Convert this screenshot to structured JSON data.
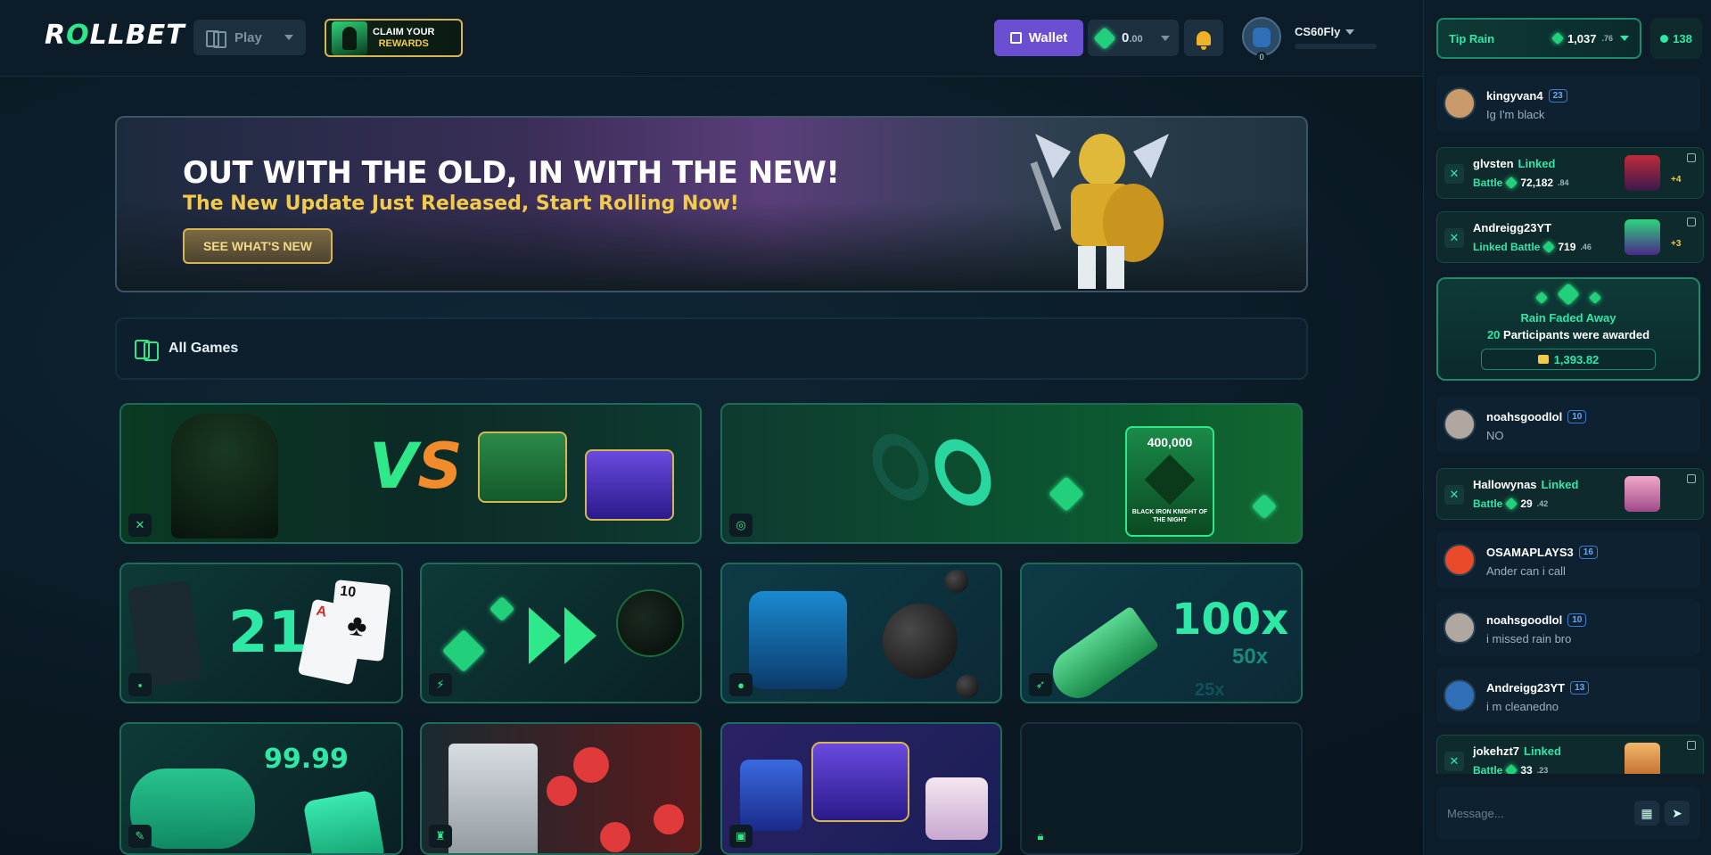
{
  "header": {
    "logo": "ROLLBET",
    "play_label": "Play",
    "claim_line1": "CLAIM YOUR",
    "claim_line2": "REWARDS",
    "wallet_label": "Wallet",
    "balance_main": "0",
    "balance_cents": ".00",
    "username": "CS60Fly",
    "avatar_level": "0"
  },
  "banner": {
    "title": "OUT WITH THE OLD, IN WITH THE NEW!",
    "subtitle": "The New Update Just Released, Start Rolling Now!",
    "cta": "SEE WHAT'S NEW"
  },
  "games": {
    "section_title": "All Games",
    "tiles": [
      {
        "name": "battles",
        "text": "VS"
      },
      {
        "name": "rain",
        "text": "400,000",
        "sub": "BLACK IRON KNIGHT OF THE NIGHT"
      },
      {
        "name": "blackjack",
        "text": "21",
        "card": "10"
      },
      {
        "name": "upgrade",
        "text": ""
      },
      {
        "name": "mines",
        "text": ""
      },
      {
        "name": "crash",
        "text": "100x",
        "t2": "50x",
        "t3": "25x"
      },
      {
        "name": "dice",
        "text": "99.99"
      },
      {
        "name": "towers",
        "text": ""
      },
      {
        "name": "cases",
        "text": ""
      },
      {
        "name": "locked",
        "text": ""
      }
    ]
  },
  "chat": {
    "tip_rain_label": "Tip Rain",
    "tip_rain_amount": "1,037",
    "tip_rain_cents": ".76",
    "online_count": "138",
    "messages": [
      {
        "type": "msg",
        "name": "kingyvan4",
        "level": "23",
        "text": "Ig I'm black"
      },
      {
        "type": "battle",
        "name": "glvsten",
        "tag": "Linked",
        "label": "Battle",
        "value": "72,182",
        "cents": ".84",
        "plus": "+4"
      },
      {
        "type": "battle",
        "name": "Andreigg23YT",
        "tag": "",
        "label": "Linked Battle",
        "value": "719",
        "cents": ".46",
        "plus": "+3"
      },
      {
        "type": "rain",
        "title": "Rain Faded Away",
        "count": "20",
        "text": "Participants were awarded",
        "amount": "1,393.82"
      },
      {
        "type": "msg",
        "name": "noahsgoodlol",
        "level": "10",
        "text": "NO"
      },
      {
        "type": "battle",
        "name": "Hallowynas",
        "tag": "Linked",
        "label": "Battle",
        "value": "29",
        "cents": ".42",
        "plus": ""
      },
      {
        "type": "msg",
        "name": "OSAMAPLAYS3",
        "level": "16",
        "text": "Ander can i call"
      },
      {
        "type": "msg",
        "name": "noahsgoodlol",
        "level": "10",
        "text": "i missed rain bro"
      },
      {
        "type": "msg",
        "name": "Andreigg23YT",
        "level": "13",
        "text": "i m cleanedno"
      },
      {
        "type": "battle",
        "name": "jokehzt7",
        "tag": "Linked",
        "label": "Battle",
        "value": "33",
        "cents": ".23",
        "plus": ""
      }
    ],
    "input_placeholder": "Message..."
  },
  "colors": {
    "accent": "#2ee88a",
    "gold": "#f3cb4a",
    "wallet": "#6b4fd3"
  }
}
